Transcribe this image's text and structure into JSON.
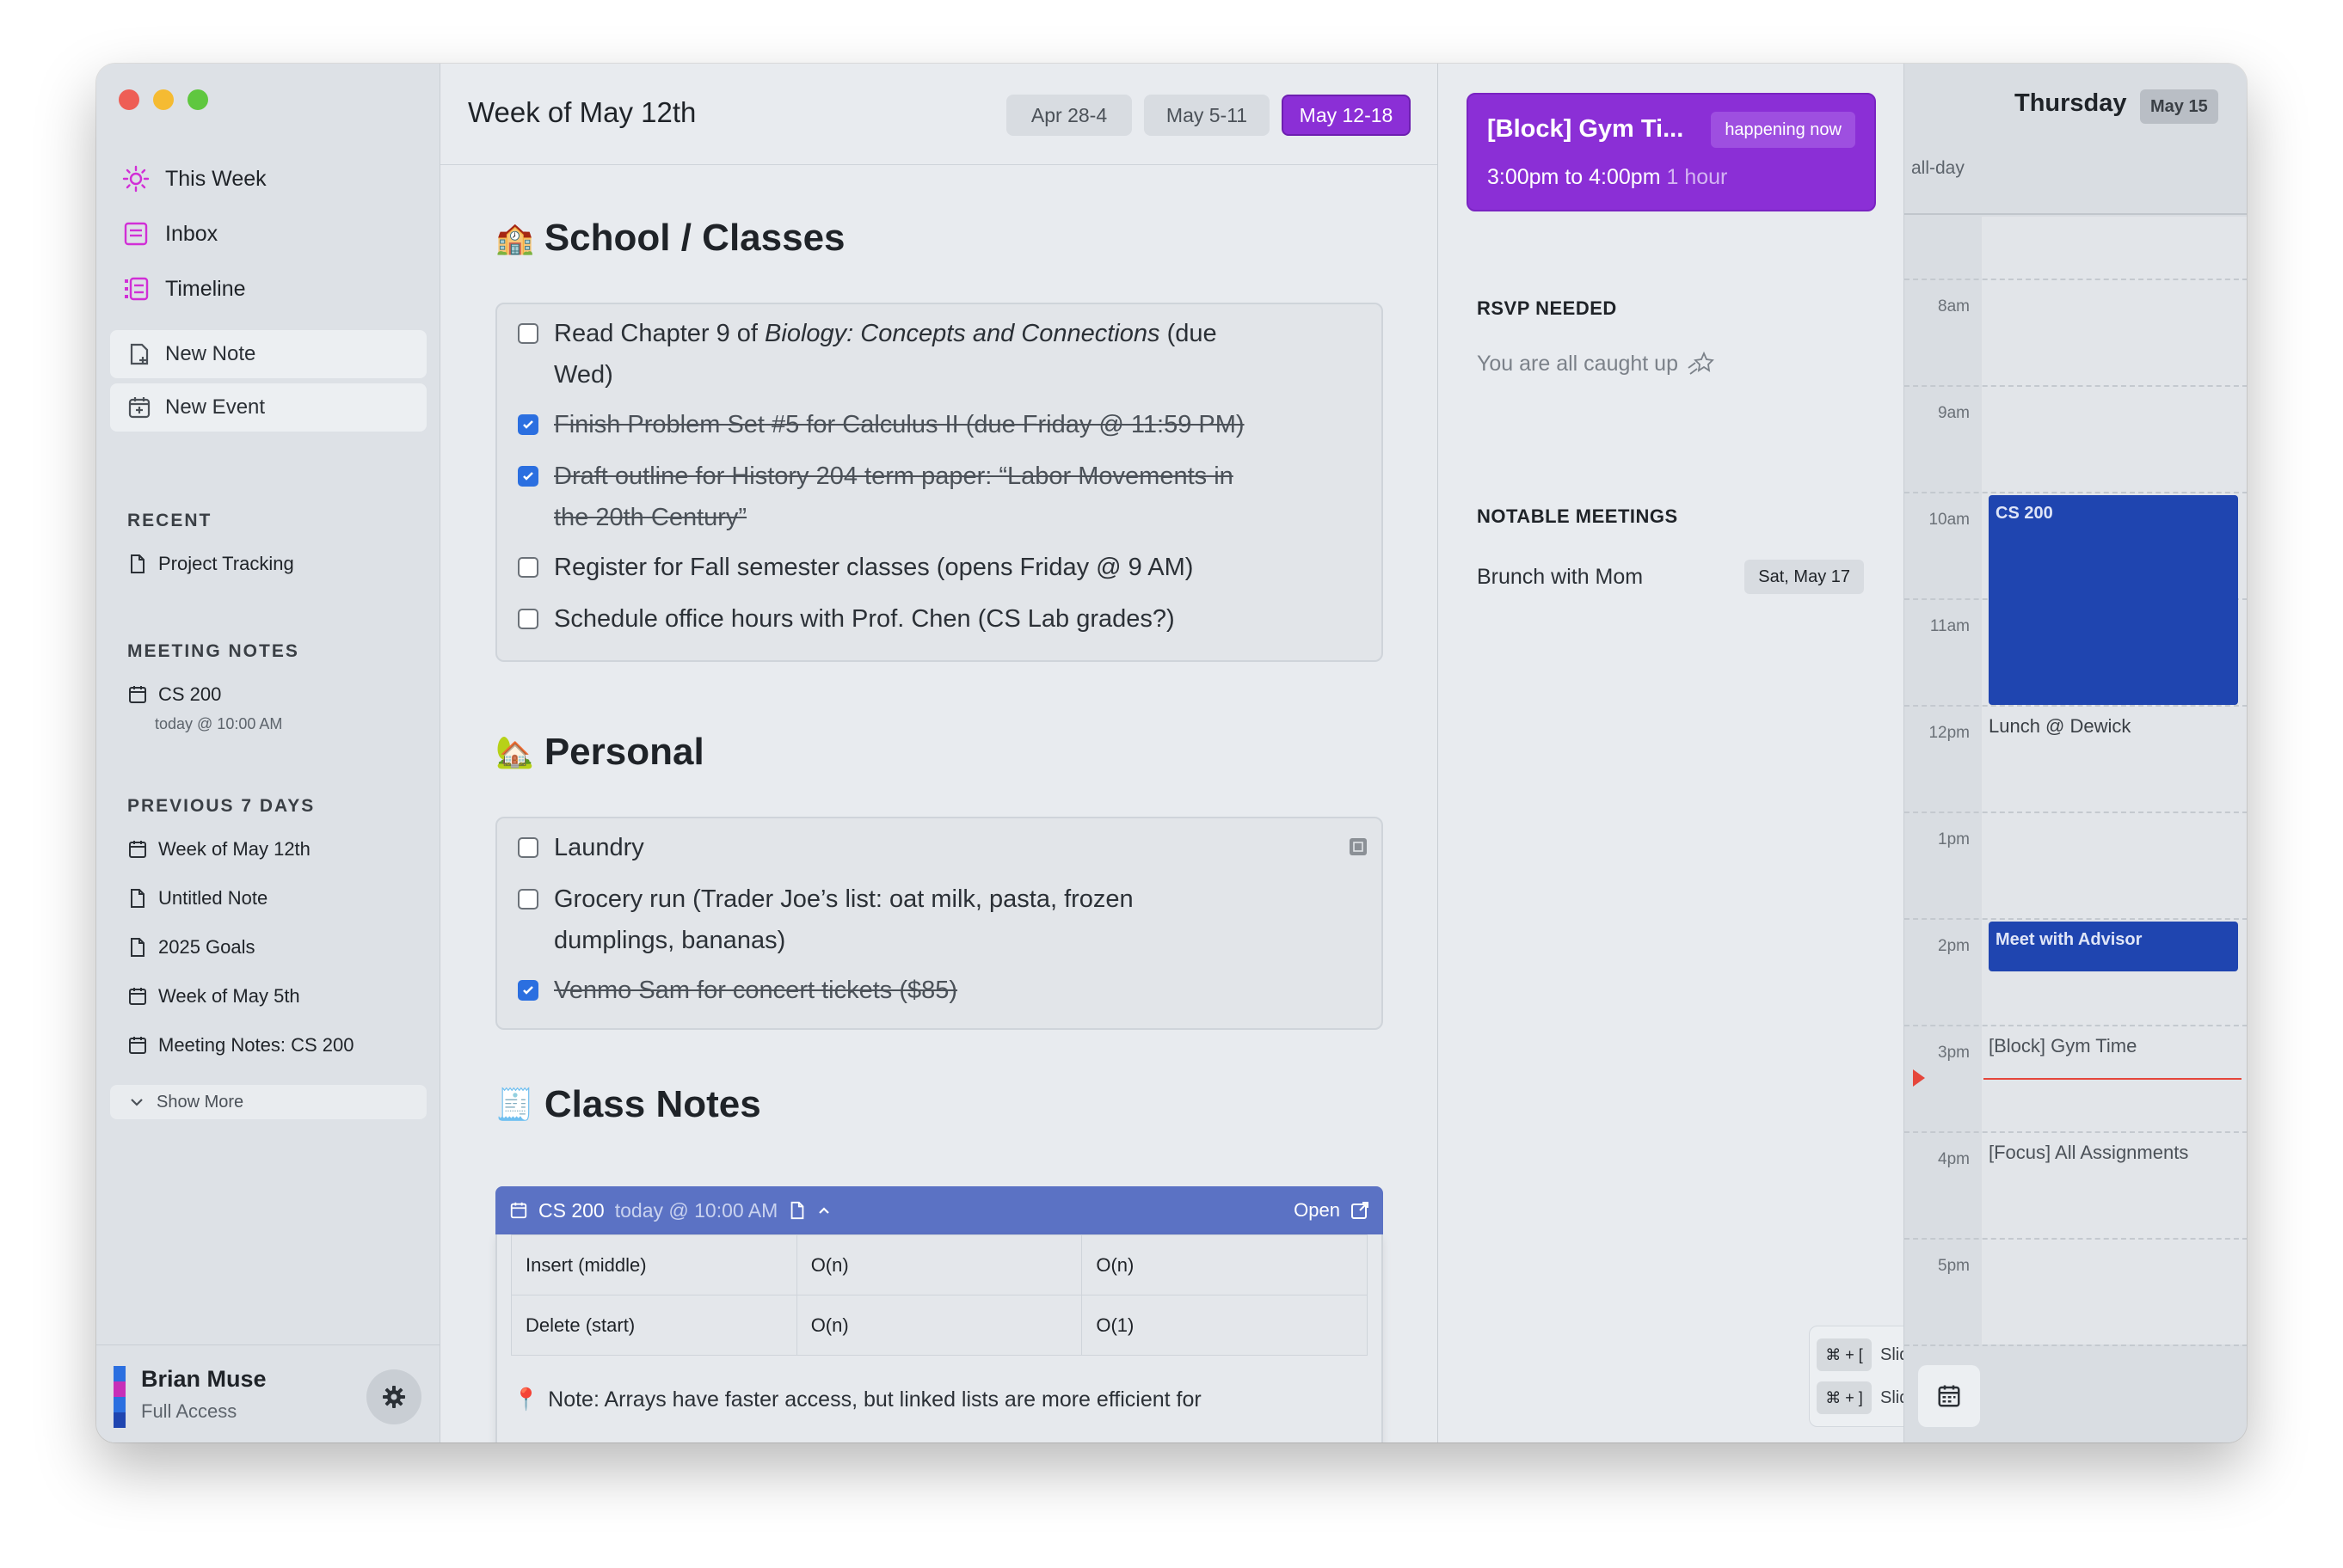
{
  "sidebar": {
    "nav": [
      {
        "label": "This Week",
        "icon": "sun-icon"
      },
      {
        "label": "Inbox",
        "icon": "inbox-icon"
      },
      {
        "label": "Timeline",
        "icon": "timeline-icon"
      }
    ],
    "new_note": "New Note",
    "new_event": "New Event",
    "recent_head": "RECENT",
    "recent": [
      {
        "label": "Project Tracking"
      }
    ],
    "meeting_head": "MEETING NOTES",
    "meeting": {
      "label": "CS 200",
      "sub": "today @ 10:00 AM"
    },
    "prev_head": "PREVIOUS 7 DAYS",
    "prev": [
      {
        "label": "Week of May 12th",
        "icon": "calendar-icon"
      },
      {
        "label": "Untitled Note",
        "icon": "document-icon"
      },
      {
        "label": "2025 Goals",
        "icon": "document-icon"
      },
      {
        "label": "Week of May 5th",
        "icon": "calendar-icon"
      },
      {
        "label": "Meeting Notes: CS 200",
        "icon": "calendar-icon"
      }
    ],
    "show_more": "Show More",
    "user": {
      "name": "Brian Muse",
      "role": "Full Access"
    }
  },
  "main": {
    "title": "Week of May 12th",
    "weeks": [
      {
        "label": "Apr 28-4",
        "active": false
      },
      {
        "label": "May 5-11",
        "active": false
      },
      {
        "label": "May 12-18",
        "active": true
      }
    ],
    "school": {
      "title": "School / Classes",
      "emoji": "🏫",
      "t1_a": "Read Chapter 9 of ",
      "t1_b": "Biology: Concepts and Connections",
      "t1_c": " (due",
      "t1_d": "Wed)",
      "t2": "Finish Problem Set #5 for Calculus II (due Friday @ 11:59 PM)",
      "t3_a": "Draft outline for History 204 term paper: “Labor Movements in",
      "t3_b": "the 20th Century”",
      "t4": "Register for Fall semester classes (opens Friday @ 9 AM)",
      "t5": "Schedule office hours with Prof. Chen (CS Lab grades?)"
    },
    "personal": {
      "title": "Personal",
      "emoji": "🏡",
      "t1": "Laundry",
      "t2_a": "Grocery run (Trader Joe’s list: oat milk, pasta, frozen",
      "t2_b": "dumplings, bananas)",
      "t3": "Venmo Sam for concert tickets ($85)"
    },
    "class_notes": {
      "title": "Class Notes",
      "emoji": "🧾",
      "head_title": "CS 200",
      "head_time": "today @ 10:00 AM",
      "open": "Open",
      "rows": [
        [
          "Insert (middle)",
          "O(n)",
          "O(n)"
        ],
        [
          "Delete (start)",
          "O(n)",
          "O(1)"
        ]
      ],
      "note_pin": "📍",
      "note": "Note: Arrays have faster access, but linked lists are more efficient for"
    }
  },
  "right": {
    "now_title": "[Block] Gym Ti...",
    "now_badge": "happening now",
    "now_time": "3:00pm to 4:00pm",
    "now_dur": "1 hour",
    "rsvp_head": "RSVP NEEDED",
    "caught_up": "You are all caught up",
    "notable_head": "NOTABLE MEETINGS",
    "meeting_name": "Brunch with Mom",
    "meeting_date": "Sat, May 17",
    "kbd_left_key": "⌘ + [",
    "kbd_left": "Slide left",
    "kbd_right_key": "⌘ + ]",
    "kbd_right": "Slide right"
  },
  "calendar": {
    "day": "Thursday",
    "date": "May 15",
    "allday": "all-day",
    "hours": [
      "8am",
      "9am",
      "10am",
      "11am",
      "12pm",
      "1pm",
      "2pm",
      "3pm",
      "4pm",
      "5pm"
    ],
    "ev_cs200": "CS 200",
    "ev_lunch": "Lunch @ Dewick",
    "ev_advisor": "Meet with Advisor",
    "ev_gym": "[Block] Gym Time",
    "ev_focus": "[Focus] All Assignments"
  },
  "colors": {
    "accent": "#8b2fd6",
    "event_blue": "#1f45b0",
    "now_line": "#e5463b",
    "nav_icon": "#d12fd6"
  }
}
